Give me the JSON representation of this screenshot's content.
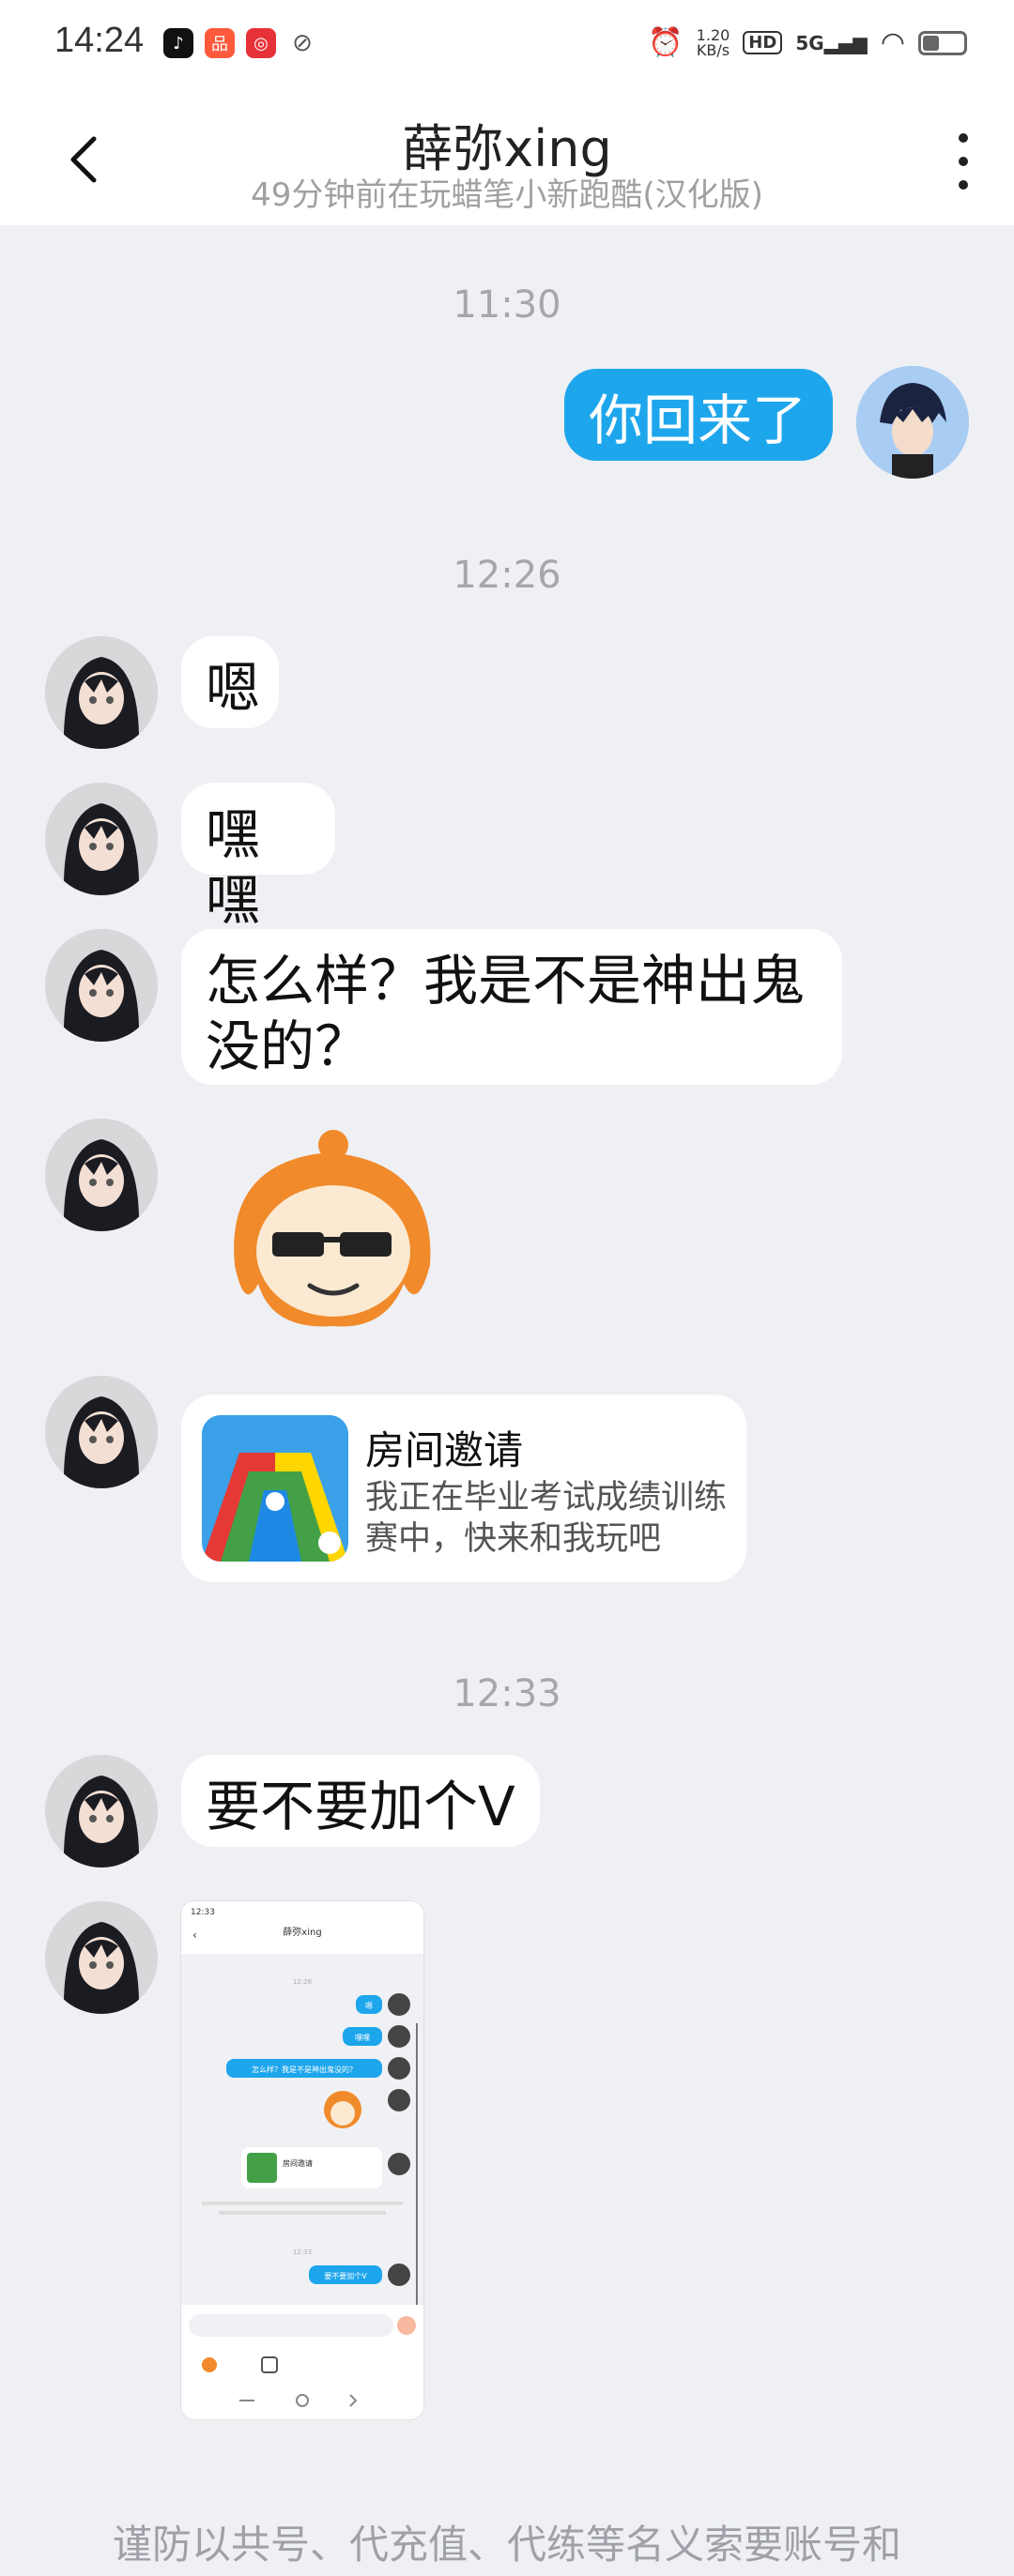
{
  "status": {
    "time": "14:24",
    "net_speed_value": "1.20",
    "net_speed_unit": "KB/s",
    "hd": "HD",
    "signal": "5G",
    "battery_level": 0.45
  },
  "header": {
    "title": "薛弥xing",
    "subtitle": "49分钟前在玩蜡笔小新跑酷(汉化版)"
  },
  "chat": {
    "time_1": "11:30",
    "time_2": "12:26",
    "time_3": "12:33",
    "msg_self_1": "你回来了",
    "msg_1": "嗯",
    "msg_2": "嘿嘿",
    "msg_3": "怎么样？我是不是神出鬼没的？",
    "card_title": "房间邀请",
    "card_desc": "我正在毕业考试成绩训练赛中，快来和我玩吧",
    "msg_4": "要不要加个V"
  },
  "mini_screenshot": {
    "time": "12:33",
    "title": "薛弥xing",
    "time_mid": "12:26",
    "bubble_1": "嗯",
    "bubble_2": "嘿嘿",
    "bubble_3": "怎么样？我是不是神出鬼没的？",
    "card_title": "房间邀请",
    "time_end": "12:33",
    "bubble_4": "要不要加个V"
  },
  "notice": "谨防以共号、代充值、代练等名义索要账号和"
}
